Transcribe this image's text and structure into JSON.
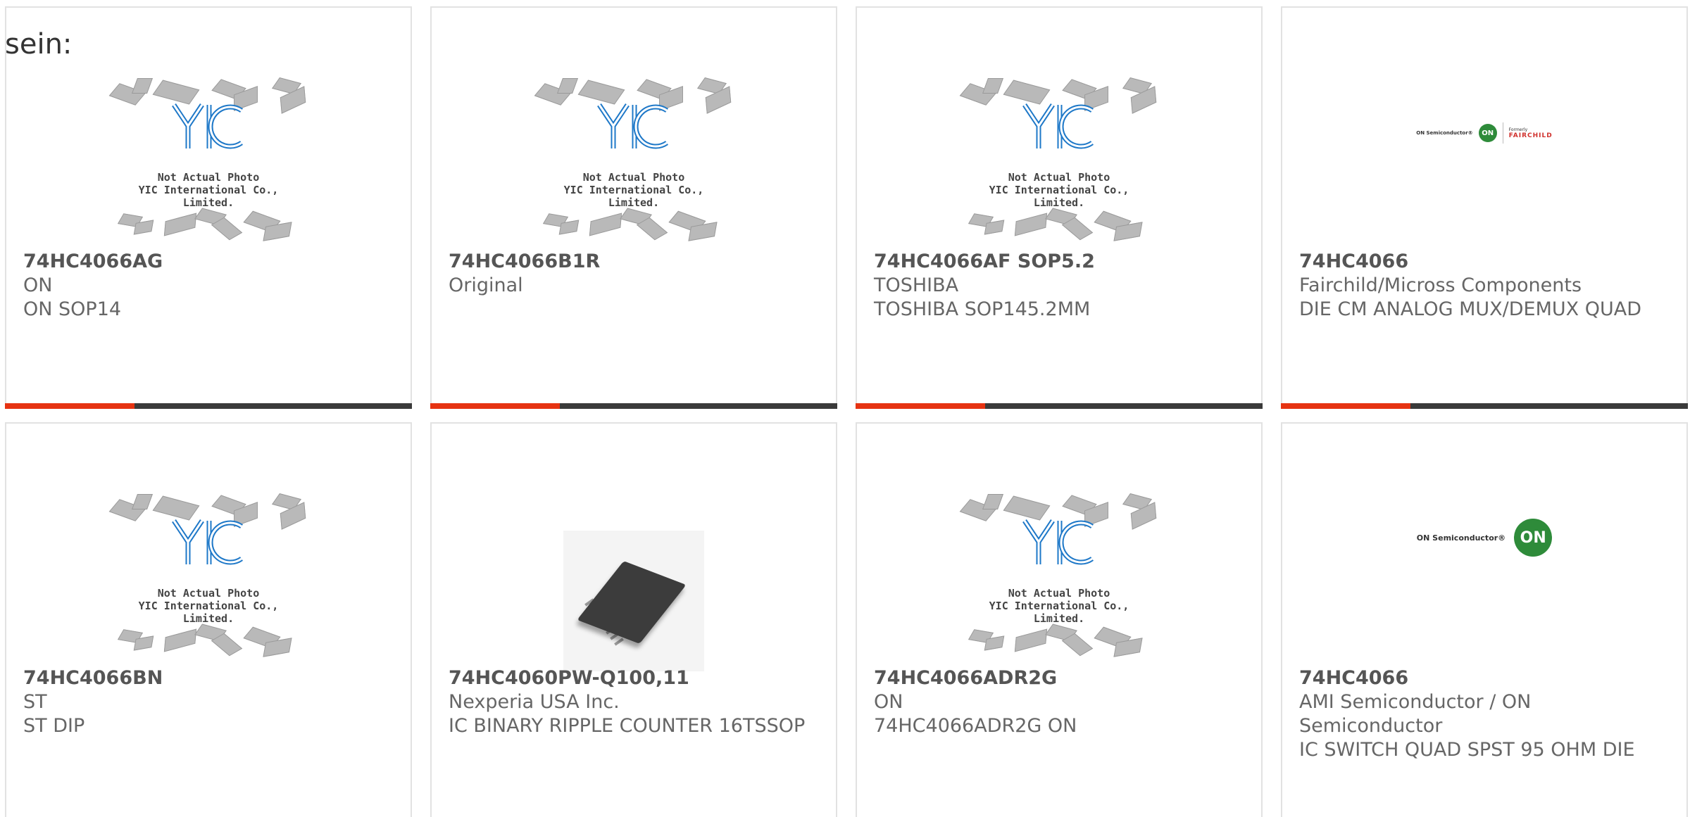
{
  "fragment_text": "sein:",
  "placeholder": {
    "line1": "Not Actual Photo",
    "line2": "YIC International Co., Limited.",
    "logo": "YIC"
  },
  "logos": {
    "fairchild_text_left": "ON Semiconductor®",
    "fairchild_small": "Formerly",
    "fairchild_name": "FAIRCHILD",
    "on_text": "ON Semiconductor®",
    "on_badge": "ON"
  },
  "products": [
    {
      "part": "74HC4066AG",
      "maker": "ON",
      "desc": "ON SOP14",
      "image": "yic-placeholder"
    },
    {
      "part": "74HC4066B1R",
      "maker": "Original",
      "desc": "",
      "image": "yic-placeholder"
    },
    {
      "part": "74HC4066AF SOP5.2",
      "maker": "TOSHIBA",
      "desc": "TOSHIBA SOP145.2MM",
      "image": "yic-placeholder"
    },
    {
      "part": "74HC4066",
      "maker": "Fairchild/Micross Components",
      "desc": "DIE CM ANALOG MUX/DEMUX QUAD",
      "image": "on-fairchild-logo"
    },
    {
      "part": "74HC4066BN",
      "maker": "ST",
      "desc": "ST DIP",
      "image": "yic-placeholder"
    },
    {
      "part": "74HC4060PW-Q100,11",
      "maker": "Nexperia USA Inc.",
      "desc": "IC BINARY RIPPLE COUNTER 16TSSOP",
      "image": "tssop-chip-photo"
    },
    {
      "part": "74HC4066ADR2G",
      "maker": "ON",
      "desc": "74HC4066ADR2G ON",
      "image": "yic-placeholder"
    },
    {
      "part": "74HC4066",
      "maker": "AMI Semiconductor / ON Semiconductor",
      "desc": "IC SWITCH QUAD SPST 95 OHM DIE",
      "image": "on-semiconductor-logo"
    }
  ],
  "colors": {
    "accent_red": "#e63312",
    "bar_dark": "#3a3a3a",
    "yic_blue": "#1e78c8",
    "on_green": "#2e8b3a"
  }
}
